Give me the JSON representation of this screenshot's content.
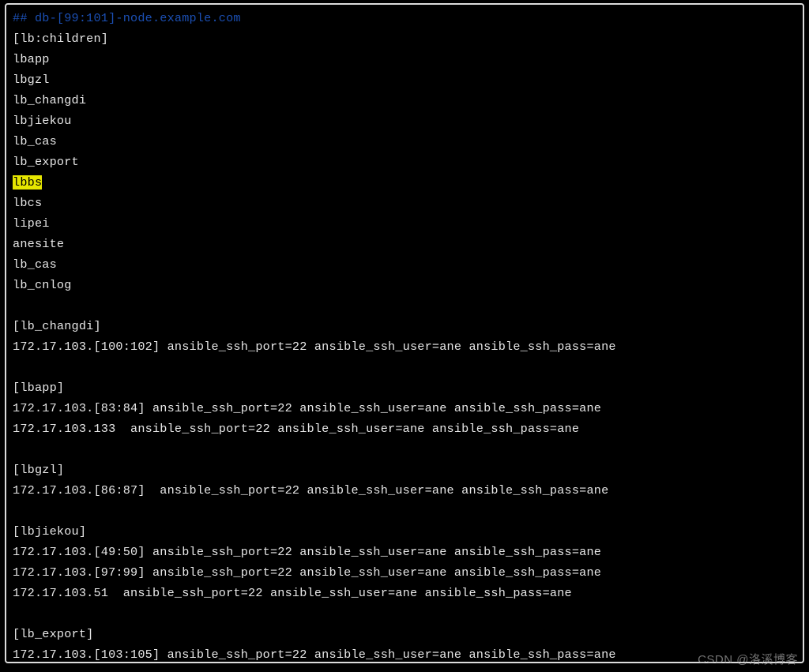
{
  "terminal": {
    "lines": [
      {
        "type": "comment",
        "text": "## db-[99:101]-node.example.com"
      },
      {
        "type": "plain",
        "text": "[lb:children]"
      },
      {
        "type": "plain",
        "text": "lbapp"
      },
      {
        "type": "plain",
        "text": "lbgzl"
      },
      {
        "type": "plain",
        "text": "lb_changdi"
      },
      {
        "type": "plain",
        "text": "lbjiekou"
      },
      {
        "type": "plain",
        "text": "lb_cas"
      },
      {
        "type": "plain",
        "text": "lb_export"
      },
      {
        "type": "hl",
        "text": "lbbs"
      },
      {
        "type": "plain",
        "text": "lbcs"
      },
      {
        "type": "plain",
        "text": "lipei"
      },
      {
        "type": "plain",
        "text": "anesite"
      },
      {
        "type": "plain",
        "text": "lb_cas"
      },
      {
        "type": "plain",
        "text": "lb_cnlog"
      },
      {
        "type": "blank",
        "text": ""
      },
      {
        "type": "plain",
        "text": "[lb_changdi]"
      },
      {
        "type": "plain",
        "text": "172.17.103.[100:102] ansible_ssh_port=22 ansible_ssh_user=ane ansible_ssh_pass=ane"
      },
      {
        "type": "blank",
        "text": ""
      },
      {
        "type": "plain",
        "text": "[lbapp]"
      },
      {
        "type": "plain",
        "text": "172.17.103.[83:84] ansible_ssh_port=22 ansible_ssh_user=ane ansible_ssh_pass=ane"
      },
      {
        "type": "plain",
        "text": "172.17.103.133  ansible_ssh_port=22 ansible_ssh_user=ane ansible_ssh_pass=ane"
      },
      {
        "type": "blank",
        "text": ""
      },
      {
        "type": "plain",
        "text": "[lbgzl]"
      },
      {
        "type": "plain",
        "text": "172.17.103.[86:87]  ansible_ssh_port=22 ansible_ssh_user=ane ansible_ssh_pass=ane"
      },
      {
        "type": "blank",
        "text": ""
      },
      {
        "type": "plain",
        "text": "[lbjiekou]"
      },
      {
        "type": "plain",
        "text": "172.17.103.[49:50] ansible_ssh_port=22 ansible_ssh_user=ane ansible_ssh_pass=ane"
      },
      {
        "type": "plain",
        "text": "172.17.103.[97:99] ansible_ssh_port=22 ansible_ssh_user=ane ansible_ssh_pass=ane"
      },
      {
        "type": "plain",
        "text": "172.17.103.51  ansible_ssh_port=22 ansible_ssh_user=ane ansible_ssh_pass=ane"
      },
      {
        "type": "blank",
        "text": ""
      },
      {
        "type": "plain",
        "text": "[lb_export]"
      },
      {
        "type": "plain",
        "text": "172.17.103.[103:105] ansible_ssh_port=22 ansible_ssh_user=ane ansible_ssh_pass=ane"
      }
    ]
  },
  "watermark": "CSDN @洛溪博客"
}
